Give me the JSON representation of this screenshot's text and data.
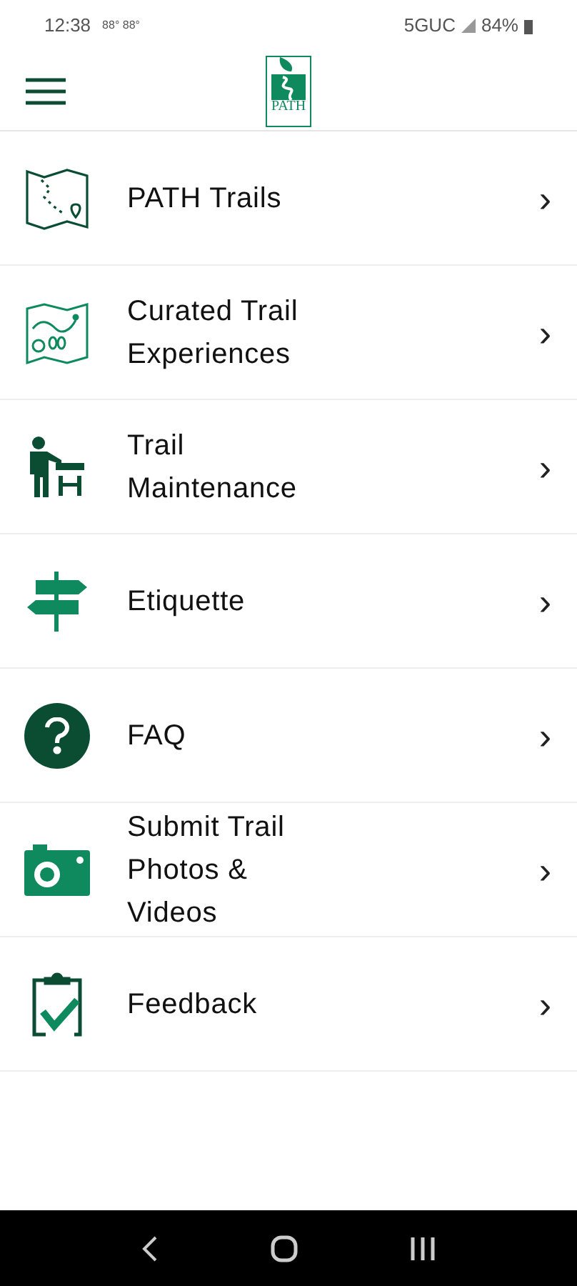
{
  "status_bar": {
    "time": "12:38",
    "weather": "88° 88°",
    "network": "5GUC",
    "battery": "84%"
  },
  "header": {
    "logo_text": "PATH"
  },
  "menu_items": [
    {
      "kind": "map",
      "label": "PATH Trails",
      "chevron": "›"
    },
    {
      "kind": "curated",
      "label": "Curated Trail Experiences",
      "chevron": "›"
    },
    {
      "kind": "maintenance",
      "label": "Trail Maintenance",
      "chevron": "›"
    },
    {
      "kind": "signpost",
      "label": "Etiquette",
      "chevron": "›"
    },
    {
      "kind": "faq",
      "label": "FAQ",
      "chevron": "›"
    },
    {
      "kind": "camera",
      "label": "Submit Trail Photos & Videos",
      "chevron": "›"
    },
    {
      "kind": "clipboard",
      "label": "Feedback",
      "chevron": "›"
    }
  ]
}
